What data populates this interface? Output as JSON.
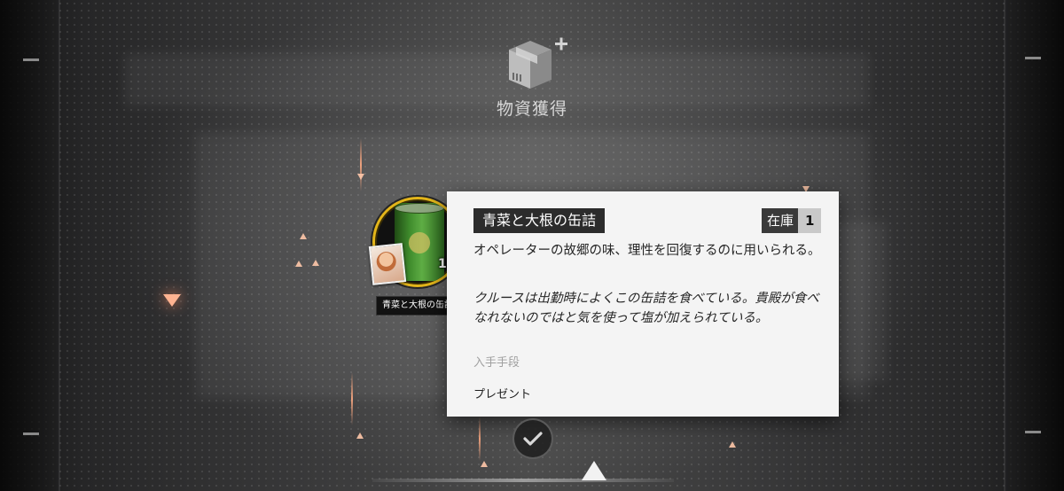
{
  "header": {
    "title": "物資獲得",
    "icon": "supply-box-plus-icon"
  },
  "item": {
    "name": "青菜と大根の缶詰",
    "quantity": "1",
    "icon": "canned-food-icon",
    "rarity_color": "#e3b51a"
  },
  "detail": {
    "title": "青菜と大根の缶詰",
    "stock_label": "在庫",
    "stock_value": "1",
    "description": "オペレーターの故郷の味、理性を回復するのに用いられる。",
    "flavor": "クルースは出勤時によくこの缶詰を食べている。貴殿が食べなれないのではと気を使って塩が加えられている。",
    "source_label": "入手手段",
    "source_value": "プレゼント"
  },
  "confirm": {
    "icon": "checkmark-icon"
  },
  "colors": {
    "popup_bg": "#f4f4f4",
    "title_bg": "#2c2c2c",
    "accent_gold": "#e3b51a",
    "particle": "#ffb391"
  }
}
